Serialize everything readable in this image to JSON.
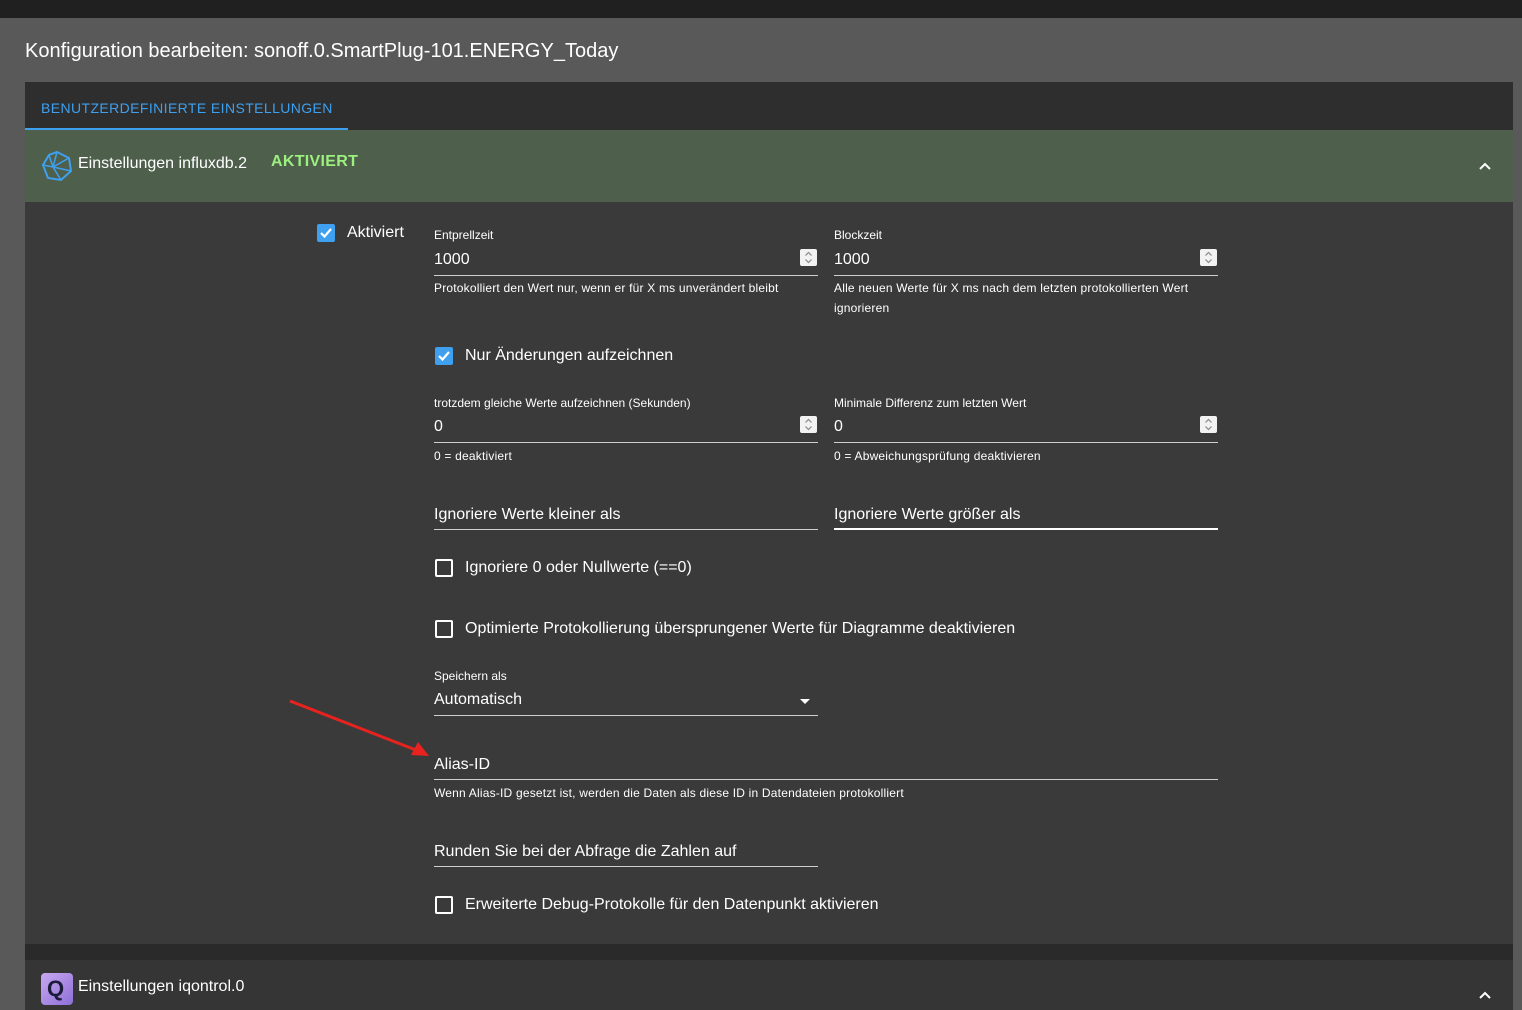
{
  "dialog": {
    "title": "Konfiguration bearbeiten: sonoff.0.SmartPlug-101.ENERGY_Today"
  },
  "tabs": [
    {
      "label": "BENUTZERDEFINIERTE EINSTELLUNGEN",
      "active": true
    }
  ],
  "influx": {
    "title": "Einstellungen influxdb.2",
    "status": "AKTIVIERT",
    "enabled_label": "Aktiviert",
    "enabled": true,
    "debounce": {
      "label": "Entprellzeit",
      "value": "1000",
      "helper": "Protokolliert den Wert nur, wenn er für X ms unverändert bleibt"
    },
    "block": {
      "label": "Blockzeit",
      "value": "1000",
      "helper": "Alle neuen Werte für X ms nach dem letzten protokollierten Wert ignorieren"
    },
    "changes_only": {
      "label": "Nur Änderungen aufzeichnen",
      "checked": true
    },
    "record_same": {
      "label": "trotzdem gleiche Werte aufzeichnen (Sekunden)",
      "value": "0",
      "helper": "0 = deaktiviert"
    },
    "min_diff": {
      "label": "Minimale Differenz zum letzten Wert",
      "value": "0",
      "helper": "0 = Abweichungsprüfung deaktivieren"
    },
    "ignore_below": {
      "placeholder": "Ignoriere Werte kleiner als",
      "value": ""
    },
    "ignore_above": {
      "placeholder": "Ignoriere Werte größer als",
      "value": ""
    },
    "ignore_zero": {
      "label": "Ignoriere 0 oder Nullwerte (==0)",
      "checked": false
    },
    "disable_skipped": {
      "label": "Optimierte Protokollierung übersprungener Werte für Diagramme deaktivieren",
      "checked": false
    },
    "store_as": {
      "label": "Speichern als",
      "value": "Automatisch"
    },
    "alias": {
      "placeholder": "Alias-ID",
      "value": "",
      "helper": "Wenn Alias-ID gesetzt ist, werden die Daten als diese ID in Datendateien protokolliert"
    },
    "round": {
      "placeholder": "Runden Sie bei der Abfrage die Zahlen auf",
      "value": ""
    },
    "debug": {
      "label": "Erweiterte Debug-Protokolle für den Datenpunkt aktivieren",
      "checked": false
    }
  },
  "iqontrol": {
    "title": "Einstellungen iqontrol.0",
    "icon_letter": "Q"
  },
  "colors": {
    "accent": "#3ea0ef",
    "active_status": "#9cf07e",
    "header_bg": "#4e5f4c",
    "arrow": "#e8231f"
  }
}
